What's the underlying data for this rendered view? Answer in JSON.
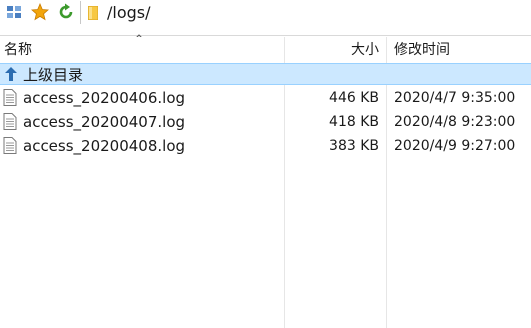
{
  "toolbar": {
    "buttons": [
      {
        "name": "root-nav-button",
        "icon": "tree-icon"
      },
      {
        "name": "bookmark-button",
        "icon": "star-icon"
      },
      {
        "name": "refresh-button",
        "icon": "refresh-icon"
      }
    ]
  },
  "path": {
    "folder_icon": "folder-icon",
    "value": "/logs/"
  },
  "columns": {
    "name": "名称",
    "size": "大小",
    "modified": "修改时间"
  },
  "parent_row": {
    "label": "上级目录",
    "icon": "up-arrow-icon"
  },
  "files": [
    {
      "name": "access_20200406.log",
      "size": "446 KB",
      "modified": "2020/4/7 9:35:00"
    },
    {
      "name": "access_20200407.log",
      "size": "418 KB",
      "modified": "2020/4/8 9:23:00"
    },
    {
      "name": "access_20200408.log",
      "size": "383 KB",
      "modified": "2020/4/9 9:27:00"
    }
  ],
  "colors": {
    "selection_bg": "#cce8ff",
    "selection_border": "#99d1ff",
    "star": "#f2a50c",
    "refresh": "#3c9a2c",
    "up_arrow": "#2b6cb0"
  }
}
